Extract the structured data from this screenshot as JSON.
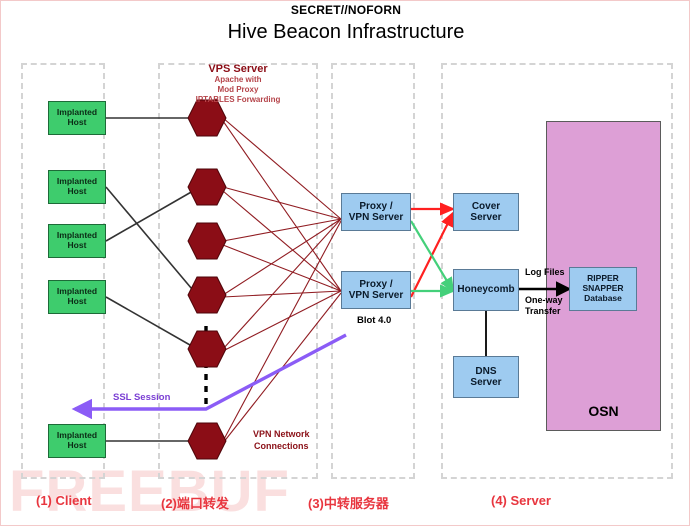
{
  "header": {
    "classification": "SECRET//NOFORN",
    "title": "Hive Beacon  Infrastructure"
  },
  "watermark": "FREEBUF",
  "vps": {
    "title": "VPS Server",
    "subtitle": "Apache with\nMod Proxy\nIPTABLES  Forwarding"
  },
  "clients": [
    {
      "label": "Implanted\nHost"
    },
    {
      "label": "Implanted\nHost"
    },
    {
      "label": "Implanted\nHost"
    },
    {
      "label": "Implanted\nHost"
    },
    {
      "label": "Implanted\nHost"
    }
  ],
  "hexagons": [
    {
      "name": "vps-node-1"
    },
    {
      "name": "vps-node-2"
    },
    {
      "name": "vps-node-3"
    },
    {
      "name": "vps-node-4"
    },
    {
      "name": "vps-node-5"
    },
    {
      "name": "vps-node-6"
    }
  ],
  "relay": {
    "proxy1": "Proxy /\nVPN Server",
    "proxy2": "Proxy /\nVPN Server",
    "blot": "Blot 4.0"
  },
  "servers": {
    "cover": "Cover\nServer",
    "honeycomb": "Honeycomb",
    "dns": "DNS\nServer",
    "database": "RIPPER\nSNAPPER\nDatabase",
    "osn": "OSN"
  },
  "annotations": {
    "ssl_session": "SSL Session",
    "vpn_network": "VPN Network\nConnections",
    "log_files": "Log Files",
    "one_way": "One-way\nTransfer"
  },
  "stages": [
    {
      "label": "(1) Client"
    },
    {
      "label": "(2)端口转发"
    },
    {
      "label": "(3)中转服务器"
    },
    {
      "label": "(4) Server"
    }
  ],
  "colors": {
    "client_fill": "#3ecc6d",
    "hexagon_fill": "#8b0d16",
    "relay_fill": "#9ecbf0",
    "osn_fill": "#dd9fd6",
    "red_arrow": "#ff2020",
    "green_arrow": "#44d07a",
    "purple_arrow": "#8b5cf6",
    "stage_caption": "#e8363f"
  }
}
